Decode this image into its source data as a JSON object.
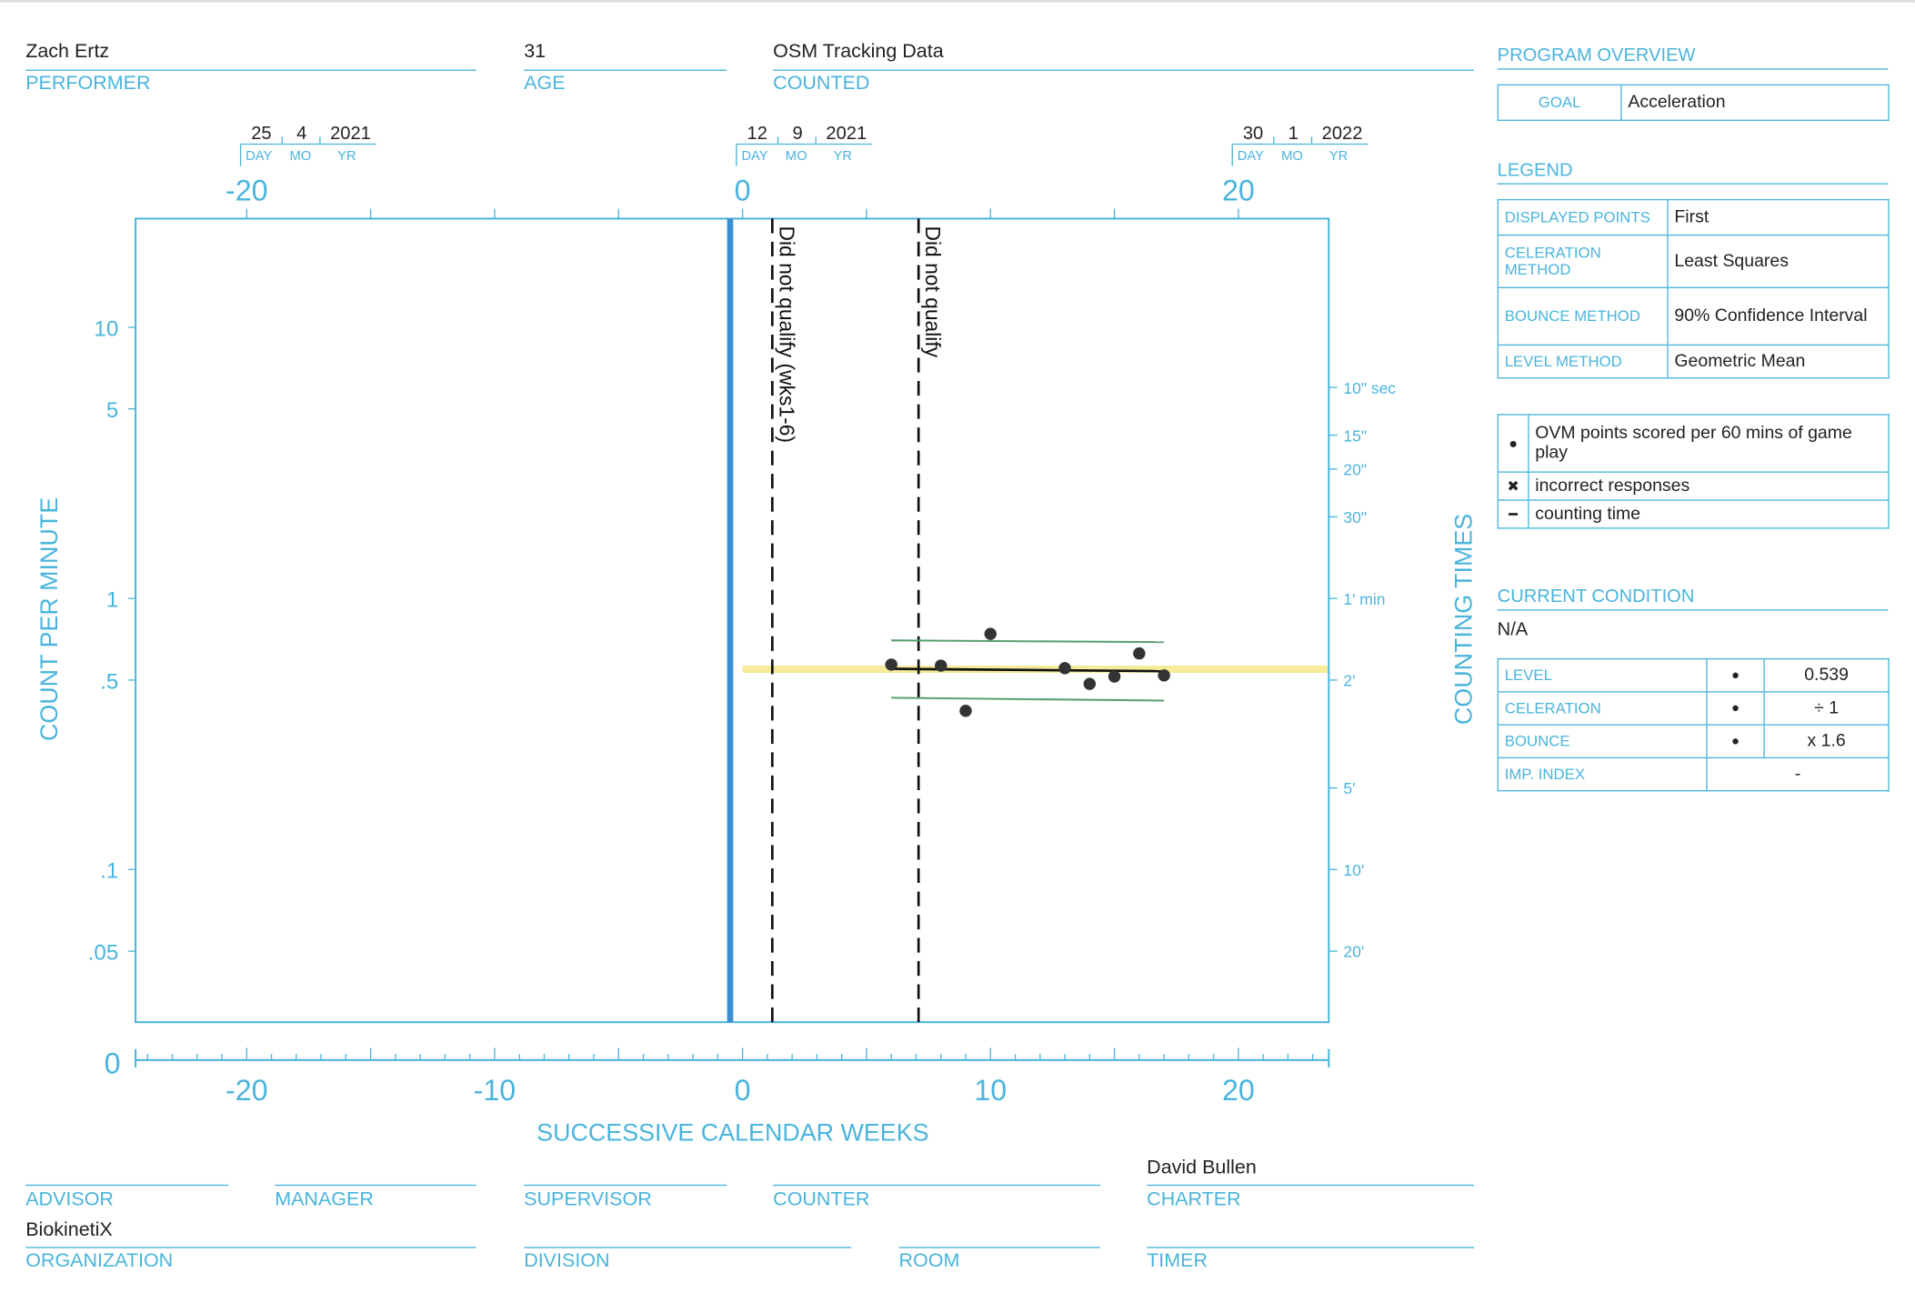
{
  "header": {
    "performer": {
      "value": "Zach Ertz",
      "label": "PERFORMER"
    },
    "age": {
      "value": "31",
      "label": "AGE"
    },
    "counted": {
      "value": "OSM Tracking Data",
      "label": "COUNTED"
    }
  },
  "footer": {
    "advisor": {
      "value": "",
      "label": "ADVISOR"
    },
    "manager": {
      "value": "",
      "label": "MANAGER"
    },
    "supervisor": {
      "value": "",
      "label": "SUPERVISOR"
    },
    "counter": {
      "value": "",
      "label": "COUNTER"
    },
    "charter": {
      "value": "David Bullen",
      "label": "CHARTER"
    },
    "organization": {
      "value": "BiokinetiX",
      "label": "ORGANIZATION"
    },
    "division": {
      "value": "",
      "label": "DIVISION"
    },
    "room": {
      "value": "",
      "label": "ROOM"
    },
    "timer": {
      "value": "",
      "label": "TIMER"
    }
  },
  "program_overview": {
    "title": "PROGRAM OVERVIEW",
    "goal_label": "GOAL",
    "goal_value": "Acceleration"
  },
  "legend": {
    "title": "LEGEND",
    "rows": [
      {
        "key": "DISPLAYED POINTS",
        "value": "First"
      },
      {
        "key": "CELERATION METHOD",
        "value": "Least Squares"
      },
      {
        "key": "BOUNCE METHOD",
        "value": "90% Confidence Interval"
      },
      {
        "key": "LEVEL METHOD",
        "value": "Geometric Mean"
      }
    ],
    "symbols": [
      {
        "icon": "dot-icon",
        "glyph": "●",
        "label": "OVM points scored per 60 mins of game play"
      },
      {
        "icon": "x-icon",
        "glyph": "✖",
        "label": "incorrect responses"
      },
      {
        "icon": "dash-icon",
        "glyph": "━",
        "label": "counting time"
      }
    ]
  },
  "current_condition": {
    "title": "CURRENT CONDITION",
    "value": "N/A",
    "rows": [
      {
        "key": "LEVEL",
        "symbol": "●",
        "value": "0.539"
      },
      {
        "key": "CELERATION",
        "symbol": "●",
        "value": "÷ 1"
      },
      {
        "key": "BOUNCE",
        "symbol": "●",
        "value": "x 1.6"
      },
      {
        "key": "IMP. INDEX",
        "symbol": "",
        "value": "-"
      }
    ]
  },
  "chart_data": {
    "type": "scatter",
    "scale": "log-y",
    "xlabel": "SUCCESSIVE CALENDAR WEEKS",
    "ylabel": "COUNT PER MINUTE",
    "y2label": "COUNTING TIMES",
    "xlim": [
      -24.5,
      23.6
    ],
    "ylim": [
      0.027,
      25
    ],
    "x_ticks": [
      "-20",
      "-10",
      "0",
      "10",
      "20"
    ],
    "x_tick_values": [
      -20,
      -10,
      0,
      10,
      20
    ],
    "x_zero_label": "0",
    "top_ticks": [
      {
        "week": -20,
        "label": "-20",
        "day": "25",
        "mo": "4",
        "yr": "2021"
      },
      {
        "week": 0,
        "label": "0",
        "day": "12",
        "mo": "9",
        "yr": "2021"
      },
      {
        "week": 20,
        "label": "20",
        "day": "30",
        "mo": "1",
        "yr": "2022"
      }
    ],
    "date_sub_labels": {
      "day": "DAY",
      "mo": "MO",
      "yr": "YR"
    },
    "y_ticks": [
      {
        "v": 10,
        "t": "10"
      },
      {
        "v": 5,
        "t": "5"
      },
      {
        "v": 1,
        "t": "1"
      },
      {
        "v": 0.5,
        "t": ".5"
      },
      {
        "v": 0.1,
        "t": ".1"
      },
      {
        "v": 0.05,
        "t": ".05"
      }
    ],
    "y2_ticks": [
      {
        "v": 6,
        "t": "10\" sec"
      },
      {
        "v": 4,
        "t": "15\""
      },
      {
        "v": 3,
        "t": "20\""
      },
      {
        "v": 2,
        "t": "30\""
      },
      {
        "v": 1,
        "t": "1' min"
      },
      {
        "v": 0.5,
        "t": "2'"
      },
      {
        "v": 0.2,
        "t": "5'"
      },
      {
        "v": 0.1,
        "t": "10'"
      },
      {
        "v": 0.05,
        "t": "20'"
      }
    ],
    "points": [
      {
        "x": 6,
        "y": 0.57
      },
      {
        "x": 8,
        "y": 0.565
      },
      {
        "x": 9,
        "y": 0.385
      },
      {
        "x": 10,
        "y": 0.74
      },
      {
        "x": 13,
        "y": 0.553
      },
      {
        "x": 14,
        "y": 0.484
      },
      {
        "x": 15,
        "y": 0.515
      },
      {
        "x": 16,
        "y": 0.627
      },
      {
        "x": 17,
        "y": 0.52
      }
    ],
    "celeration_line": {
      "x": [
        6,
        17
      ],
      "y": [
        0.55,
        0.539
      ]
    },
    "bounce_upper": {
      "x": [
        6,
        17
      ],
      "y": [
        0.7,
        0.69
      ]
    },
    "bounce_lower": {
      "x": [
        6,
        17
      ],
      "y": [
        0.43,
        0.42
      ]
    },
    "aim_line": {
      "x": [
        0,
        23.6
      ],
      "y": [
        0.548,
        0.548
      ]
    },
    "phase_line_week": -0.5,
    "notes": [
      {
        "week": 1.2,
        "text": "Did not qualify (wks1-6)"
      },
      {
        "week": 7.1,
        "text": "Did not qualify"
      }
    ],
    "colors": {
      "axis": "#4ab4dc",
      "phase": "#3b8fd0",
      "points": "#333333",
      "bounce": "#5a9e6f",
      "aim": "#f5eb9a",
      "celeration": "#111111"
    }
  }
}
